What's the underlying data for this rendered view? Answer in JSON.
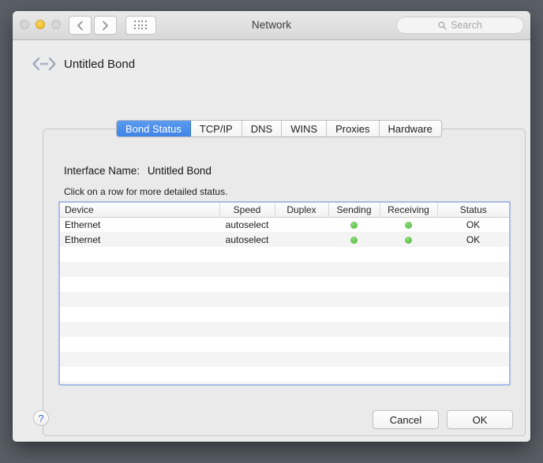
{
  "window": {
    "title": "Network",
    "traffic_lights": [
      {
        "name": "close-button",
        "state": "inactive",
        "color": "#d6d6d6"
      },
      {
        "name": "minimize-button",
        "state": "active",
        "color": "#f2bc34"
      },
      {
        "name": "zoom-button",
        "state": "inactive",
        "color": "#d6d6d6"
      }
    ],
    "nav": {
      "back_icon": "chevron-left-icon",
      "forward_icon": "chevron-right-icon",
      "grid_icon": "show-all-grid-icon"
    },
    "search": {
      "placeholder": "Search",
      "value": "",
      "icon": "search-icon"
    }
  },
  "header": {
    "icon": "bond-interface-icon",
    "title": "Untitled Bond"
  },
  "tabs": [
    {
      "label": "Bond Status",
      "active": true
    },
    {
      "label": "TCP/IP",
      "active": false
    },
    {
      "label": "DNS",
      "active": false
    },
    {
      "label": "WINS",
      "active": false
    },
    {
      "label": "Proxies",
      "active": false
    },
    {
      "label": "Hardware",
      "active": false
    }
  ],
  "panel": {
    "interface_name_label": "Interface Name:",
    "interface_name_value": "Untitled Bond",
    "hint": "Click on a row for more detailed status."
  },
  "table": {
    "columns": [
      "Device",
      "Speed",
      "Duplex",
      "Sending",
      "Receiving",
      "Status"
    ],
    "rows": [
      {
        "device": "Ethernet",
        "speed": "autoselect",
        "duplex": "",
        "sending": "status-dot-green",
        "receiving": "status-dot-green",
        "status": "OK"
      },
      {
        "device": "Ethernet",
        "speed": "autoselect",
        "duplex": "",
        "sending": "status-dot-green",
        "receiving": "status-dot-green",
        "status": "OK"
      }
    ],
    "empty_row_count": 10,
    "status_dot_color": "#63c44e",
    "focus_border_color": "#a9bce4"
  },
  "footer": {
    "help_label": "?",
    "cancel_label": "Cancel",
    "ok_label": "OK"
  }
}
